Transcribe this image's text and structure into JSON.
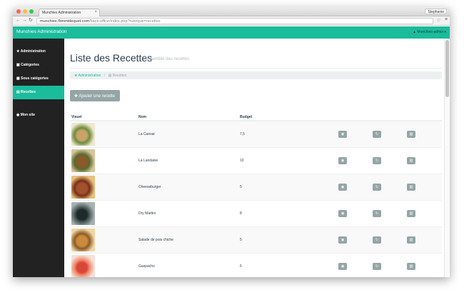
{
  "browser": {
    "tab_title": "Munchies Administration",
    "tab_close": "×",
    "profile": "Stephanie",
    "back": "←",
    "forward": "→",
    "reload": "↻",
    "url_host": "munchies.florentdequet.com",
    "url_path": "/back-office/index.php?rubrique=recettes",
    "bookmark": "☆",
    "menu": "≡"
  },
  "app": {
    "brand": "Munchies Administration",
    "user_menu": "▲ Munchies-admin ▾"
  },
  "sidebar": {
    "items": [
      {
        "icon": "★",
        "label": "Administration"
      },
      {
        "icon": "▦",
        "label": "Catégories"
      },
      {
        "icon": "▦",
        "label": "Sous catégories"
      },
      {
        "icon": "▤",
        "label": "Recettes"
      },
      {
        "icon": "◉",
        "label": "Mon site"
      }
    ]
  },
  "page": {
    "title": "Liste des Recettes",
    "subtitle": "L'ensemble des recettes",
    "breadcrumb": {
      "home_icon": "★",
      "home": "Administration",
      "separator": "/",
      "current_icon": "▤",
      "current": "Recettes"
    },
    "add_button": "✚ Ajouter une recette"
  },
  "table": {
    "headers": {
      "visuel": "Visuel",
      "nom": "Nom",
      "budget": "Budget"
    },
    "view_icon": "◉",
    "edit_icon": "↻",
    "delete_icon": "▥",
    "rows": [
      {
        "nom": "La Caesar",
        "budget": "7,5",
        "colors": [
          "#c9a36b",
          "#6b8d3a",
          "#f1e6cf"
        ]
      },
      {
        "nom": "La Landaise",
        "budget": "10",
        "colors": [
          "#8b5a2b",
          "#556b2f",
          "#d9c49a"
        ]
      },
      {
        "nom": "Cheeseburger",
        "budget": "5",
        "colors": [
          "#a0522d",
          "#7a2e1a",
          "#e6c27a"
        ]
      },
      {
        "nom": "Dry Martini",
        "budget": "8",
        "colors": [
          "#1f2a2a",
          "#4b5c5c",
          "#a7b3b0"
        ]
      },
      {
        "nom": "Salade de pois chiche",
        "budget": "5",
        "colors": [
          "#c98c3f",
          "#8e5a25",
          "#efd7a4"
        ]
      },
      {
        "nom": "Gaspacho",
        "budget": "6",
        "colors": [
          "#d9463a",
          "#f08a6a",
          "#f6e0d8"
        ]
      }
    ]
  }
}
